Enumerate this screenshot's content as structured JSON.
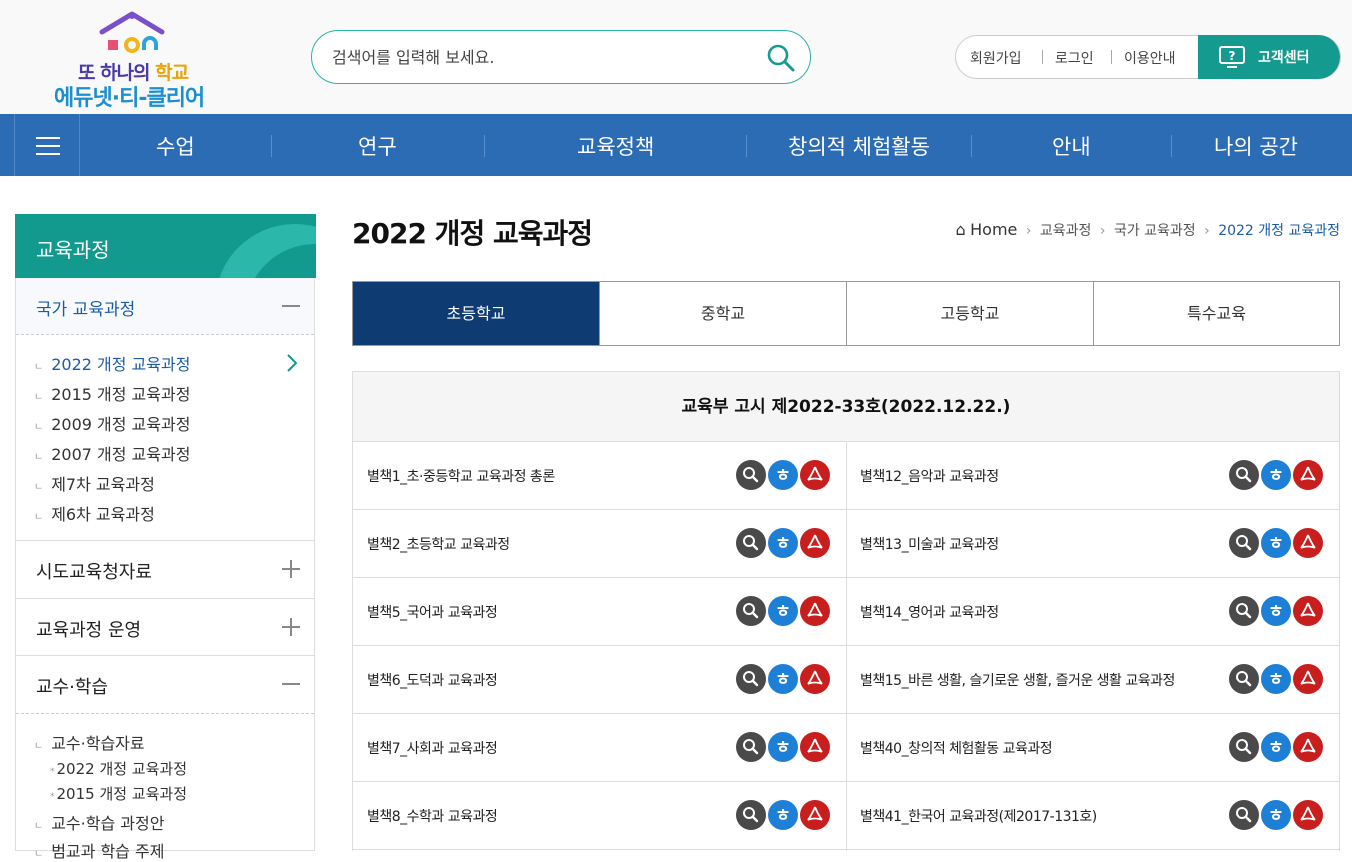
{
  "header": {
    "logo_line1_a": "또 하나의",
    "logo_line1_b": "학교",
    "logo_line2": "에듀넷·티-클리어",
    "search_placeholder": "검색어를 입력해 보세요.",
    "links": [
      "회원가입",
      "로그인",
      "이용안내"
    ],
    "customer_center": "고객센터"
  },
  "gnb": {
    "items": [
      "수업",
      "연구",
      "교육정책",
      "창의적 체험활동",
      "안내",
      "나의 공간"
    ]
  },
  "sidebar": {
    "title": "교육과정",
    "sections": [
      {
        "label": "국가 교육과정",
        "expanded": true,
        "items": [
          "2022 개정 교육과정",
          "2015 개정 교육과정",
          "2009 개정 교육과정",
          "2007 개정 교육과정",
          "제7차 교육과정",
          "제6차 교육과정"
        ]
      },
      {
        "label": "시도교육청자료",
        "expanded": false
      },
      {
        "label": "교육과정 운영",
        "expanded": false
      },
      {
        "label": "교수·학습",
        "expanded": true,
        "items": [
          "교수·학습자료",
          "2022 개정 교육과정",
          "2015 개정 교육과정",
          "교수·학습 과정안",
          "범교과 학습 주제"
        ]
      }
    ]
  },
  "main": {
    "title": "2022 개정 교육과정",
    "breadcrumb": [
      "Home",
      "교육과정",
      "국가 교육과정",
      "2022 개정 교육과정"
    ],
    "tabs": [
      "초등학교",
      "중학교",
      "고등학교",
      "특수교육"
    ],
    "active_tab": "초등학교",
    "notice": "교육부 고시 제2022-33호(2022.12.22.)",
    "docs": [
      [
        "별책1_초·중등학교 교육과정 총론",
        "별책12_음악과 교육과정"
      ],
      [
        "별책2_초등학교 교육과정",
        "별책13_미술과 교육과정"
      ],
      [
        "별책5_국어과 교육과정",
        "별책14_영어과 교육과정"
      ],
      [
        "별책6_도덕과 교육과정",
        "별책15_바른 생활, 슬기로운 생활, 즐거운 생활 교육과정"
      ],
      [
        "별책7_사회과 교육과정",
        "별책40_창의적 체험활동 교육과정"
      ],
      [
        "별책8_수학과 교육과정",
        "별책41_한국어 교육과정(제2017-131호)"
      ]
    ],
    "doc_button_icons": [
      "magnifier-icon",
      "hwp-icon",
      "pdf-icon"
    ]
  },
  "colors": {
    "gnb": "#2b6cb5",
    "teal": "#139a8e",
    "tab_active": "#0d3b72",
    "link_active": "#1a5da6"
  }
}
